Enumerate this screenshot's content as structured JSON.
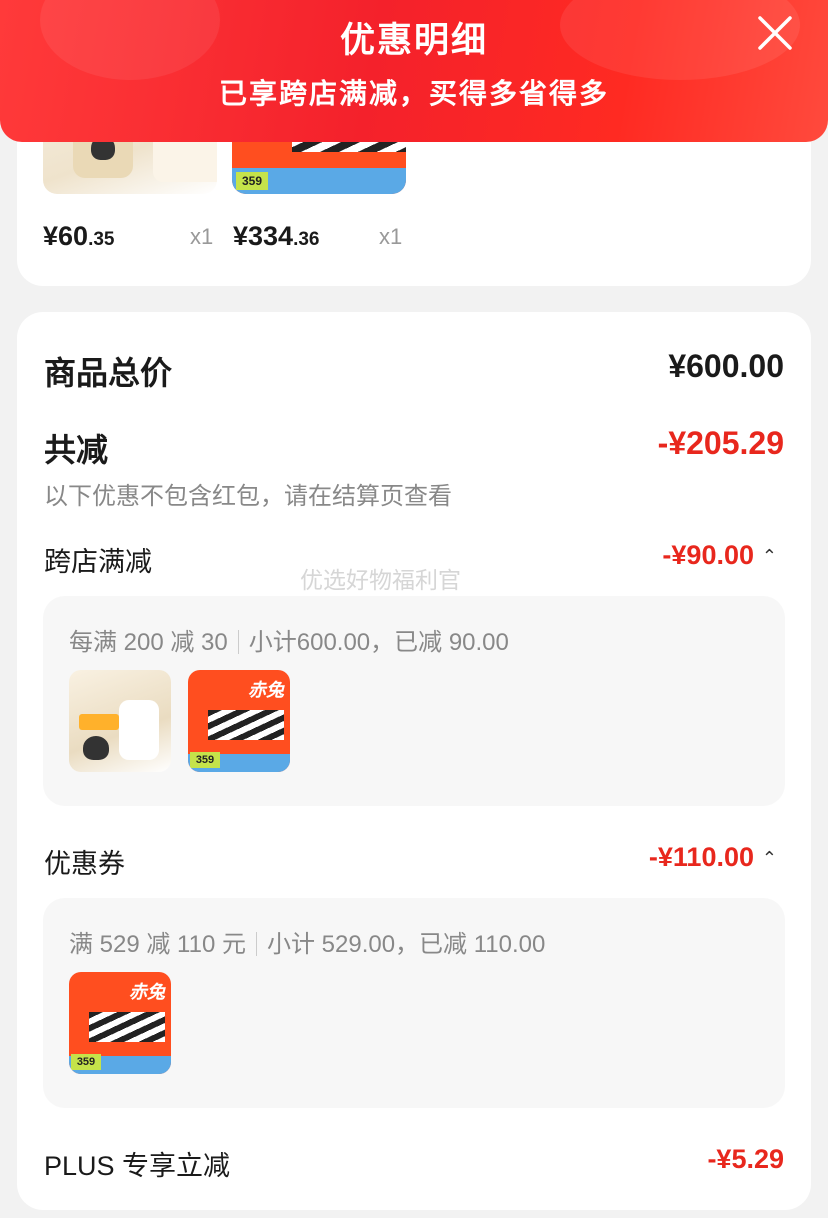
{
  "header": {
    "title": "优惠明细",
    "subtitle": "已享跨店满减，买得多省得多",
    "close_icon": "close-icon"
  },
  "items": [
    {
      "price_main": "¥60",
      "price_decimal": ".35",
      "qty": "x1"
    },
    {
      "price_main": "¥334",
      "price_decimal": ".36",
      "qty": "x1",
      "thumb_tag": "359"
    }
  ],
  "summary": {
    "total_label": "商品总价",
    "total_value": "¥600.00",
    "discount_label": "共减",
    "discount_value": "-¥205.29",
    "note": "以下优惠不包含红包，请在结算页查看"
  },
  "watermark": "优选好物福利官",
  "sections": {
    "cross_store": {
      "label": "跨店满减",
      "value": "-¥90.00",
      "rule": "每满 200 减 30",
      "detail": "小计600.00，已减 90.00",
      "shoe_tag": "359",
      "shoe_title": "赤兔"
    },
    "coupon": {
      "label": "优惠券",
      "value": "-¥110.00",
      "rule": "满 529 减 110 元",
      "detail": "小计 529.00，已减 110.00",
      "shoe_tag": "359",
      "shoe_title": "赤兔"
    },
    "plus": {
      "label": "PLUS 专享立减",
      "value": "-¥5.29"
    }
  },
  "colors": {
    "accent_red": "#e8271d",
    "header_red": "#f4212b"
  }
}
